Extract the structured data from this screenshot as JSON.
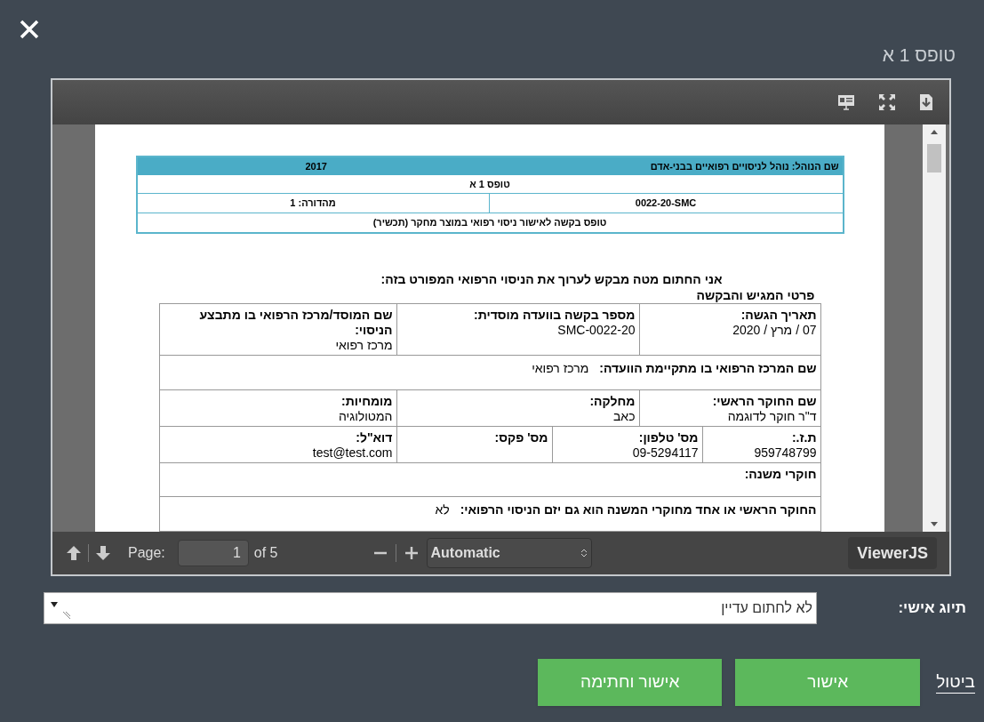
{
  "dialog": {
    "title": "טופס 1 א"
  },
  "viewer": {
    "page_label": "Page:",
    "page_value": "1",
    "page_total": "of 5",
    "zoom": "Automatic",
    "brand": "ViewerJS"
  },
  "document": {
    "header": {
      "procedure": "שם הנוהל: נוהל לניסויים רפואיים בבני-אדם",
      "year": "2017",
      "form": "טופס 1 א",
      "code": "0022-20-SMC",
      "version": "מהדורה: 1",
      "subtitle": "טופס בקשה לאישור ניסוי רפואי במוצר מחקר (תכשיר)"
    },
    "intro": "אני החתום מטה מבקש לערוך את הניסוי הרפואי המפורט בזה:",
    "section": "פרטי המגיש והבקשה",
    "rows": [
      {
        "cells": [
          {
            "kind": "stacked",
            "label": "תאריך הגשה:",
            "value": "07 / מרץ / 2020"
          },
          {
            "kind": "stacked",
            "label": "מספר בקשה בוועדה מוסדית:",
            "value": "SMC-0022-20"
          },
          {
            "kind": "stacked",
            "label": "שם המוסד/מרכז הרפואי בו מתבצע הניסוי:",
            "value": "מרכז רפואי"
          }
        ]
      },
      {
        "cells": [
          {
            "kind": "inline",
            "label": "שם המרכז הרפואי בו מתקיימת הוועדה:",
            "value": "מרכז רפואי"
          }
        ]
      },
      {
        "cells": [
          {
            "kind": "stacked",
            "label": "שם החוקר הראשי:",
            "value": "ד\"ר חוקר לדוגמה"
          },
          {
            "kind": "stacked",
            "label": "מחלקה:",
            "value": "כאב"
          },
          {
            "kind": "stacked",
            "label": "מומחיות:",
            "value": "המטולוגיה"
          }
        ]
      },
      {
        "cells": [
          {
            "kind": "stacked",
            "label": "ת.ז.:",
            "value": "959748799"
          },
          {
            "kind": "stacked",
            "label": "מס' טלפון:",
            "value": "09-5294117"
          },
          {
            "kind": "stacked",
            "label": "מס' פקס:"
          },
          {
            "kind": "stacked",
            "label": "דוא\"ל:",
            "value": "test@test.com"
          }
        ]
      },
      {
        "cells": [
          {
            "kind": "stacked",
            "label": "חוקרי משנה:"
          }
        ]
      },
      {
        "cells": [
          {
            "kind": "inline",
            "label": "החוקר הראשי או אחד מחוקרי המשנה הוא גם יזם הניסוי הרפואי:",
            "value": "לא"
          }
        ]
      }
    ]
  },
  "tag": {
    "label": "תיוג אישי:",
    "value": "לא לחתום עדיין"
  },
  "actions": {
    "cancel": "ביטול",
    "approve": "אישור",
    "approve_sign": "אישור וחתימה"
  }
}
